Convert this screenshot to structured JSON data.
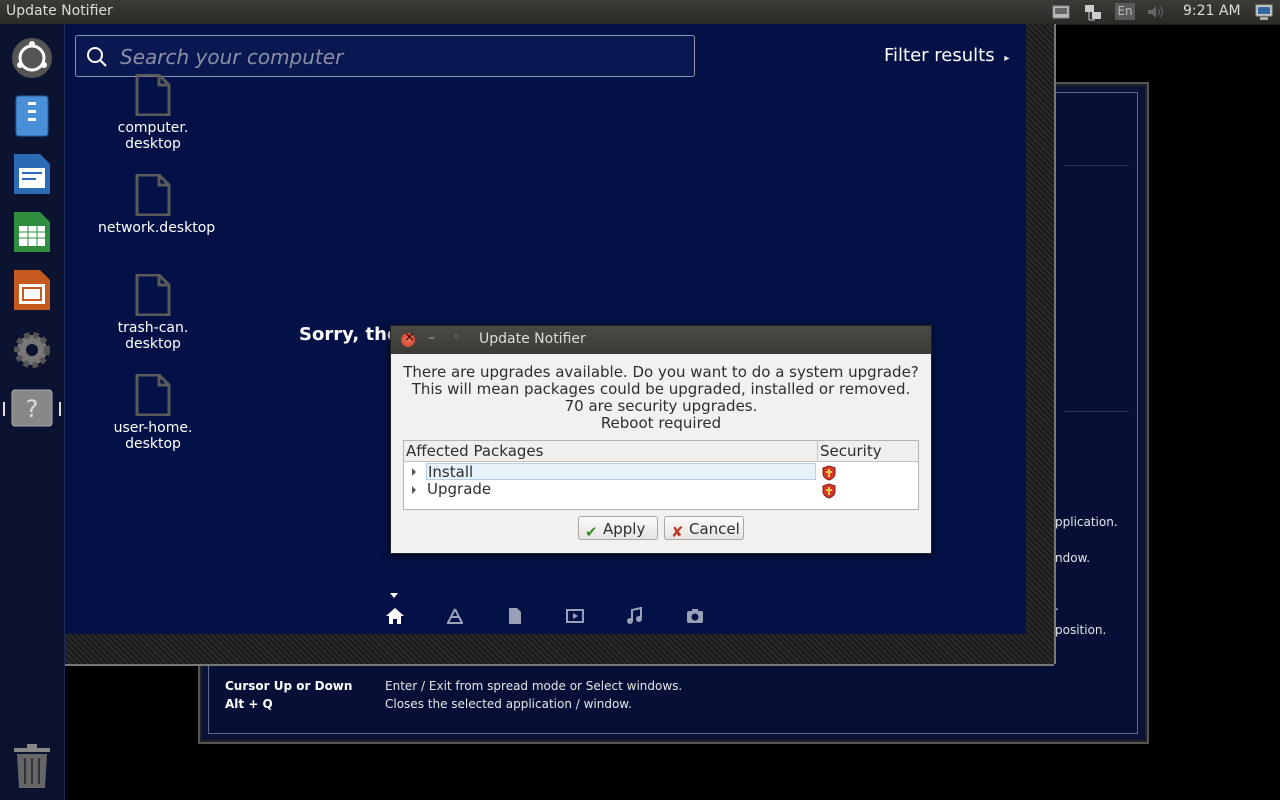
{
  "top_panel": {
    "window_title": "Update Notifier",
    "keyboard_layout": "En",
    "clock": "9:21 AM"
  },
  "launcher": {
    "items": [
      "ubuntu-logo-icon",
      "files-icon",
      "writer-icon",
      "calc-icon",
      "impress-icon",
      "settings-icon",
      "help-icon",
      "trash-icon"
    ]
  },
  "dash": {
    "search_placeholder": "Search your computer",
    "filter_label": "Filter results",
    "desktop_icons": [
      {
        "line1": "computer.",
        "line2": "desktop"
      },
      {
        "line1": "network.desktop",
        "line2": ""
      },
      {
        "line1": "trash-can.",
        "line2": "desktop"
      },
      {
        "line1": "user-home.",
        "line2": "desktop"
      }
    ],
    "no_results_text": "Sorry, the",
    "lenses": [
      "home-icon",
      "apps-icon",
      "files-icon",
      "video-icon",
      "music-icon",
      "photo-icon"
    ]
  },
  "shortcuts_window": {
    "rows": [
      {
        "key": "Cursor Up or Down",
        "desc": "Enter / Exit from spread mode or Select windows."
      },
      {
        "key": "Alt + Q",
        "desc": "Closes the selected application / window."
      }
    ],
    "fragments": [
      "pplication.",
      "ndow.",
      ".",
      "position."
    ]
  },
  "dialog": {
    "title": "Update Notifier",
    "message_lines": [
      "There are upgrades available. Do you want to do a system upgrade?",
      "This will mean packages could be upgraded, installed or removed.",
      "70 are security upgrades.",
      "Reboot required"
    ],
    "columns": [
      "Affected Packages",
      "Security"
    ],
    "rows": [
      {
        "label": "Install",
        "selected": true
      },
      {
        "label": "Upgrade",
        "selected": false
      }
    ],
    "apply_label": "Apply",
    "cancel_label": "Cancel"
  },
  "colors": {
    "dash_bg": "#031146",
    "panel_bg": "#3c3b37",
    "dialog_bg": "#f2f1f0"
  }
}
